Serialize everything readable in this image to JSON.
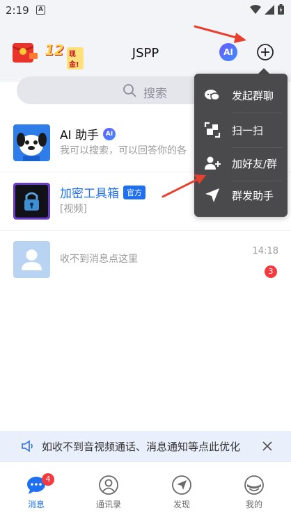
{
  "status_bar": {
    "time": "2:19",
    "app_indicator": "A"
  },
  "header": {
    "promo_amount": "12",
    "promo_cash_label": "现金!",
    "title": "JSPP",
    "ai_badge": "AI"
  },
  "search": {
    "placeholder": "搜索"
  },
  "chats": [
    {
      "name": "AI 助手",
      "tag": "AI",
      "preview": "我可以搜索，可以回答你的各",
      "time": "",
      "unread": ""
    },
    {
      "name": "加密工具箱",
      "tag": "官方",
      "preview": "[视频]",
      "time": "",
      "unread": ""
    },
    {
      "name": "",
      "tag": "",
      "preview": "收不到消息点这里",
      "time": "14:18",
      "unread": "3"
    }
  ],
  "popup_menu": {
    "items": [
      {
        "label": "发起群聊",
        "icon": "group-chat-icon"
      },
      {
        "label": "扫一扫",
        "icon": "scan-icon"
      },
      {
        "label": "加好友/群",
        "icon": "add-friend-icon"
      },
      {
        "label": "群发助手",
        "icon": "send-icon"
      }
    ]
  },
  "notice": {
    "text": "如收不到音视频通话、消息通知等点此优化"
  },
  "tabs": [
    {
      "label": "消息",
      "badge": "4",
      "icon": "chat-bubble-icon",
      "active": true
    },
    {
      "label": "通讯录",
      "icon": "contacts-icon"
    },
    {
      "label": "发现",
      "icon": "discover-icon"
    },
    {
      "label": "我的",
      "icon": "profile-icon"
    }
  ],
  "colors": {
    "accent": "#1f6ff2",
    "badge": "#f5393f",
    "popup_bg": "#4a4a4d",
    "annotation_arrow": "#e8402f"
  }
}
